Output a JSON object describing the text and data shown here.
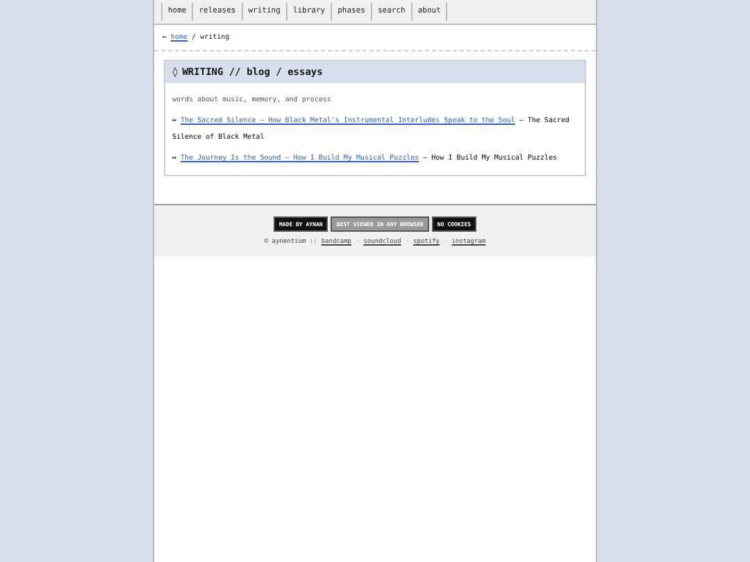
{
  "nav": [
    "home",
    "releases",
    "writing",
    "library",
    "phases",
    "search",
    "about"
  ],
  "breadcrumb": {
    "arrow": "←",
    "link": "home",
    "separator": "/",
    "current": "writing"
  },
  "section": {
    "icon": "◊",
    "title": "WRITING // blog / essays",
    "intro": "words about music, memory, and process",
    "posts": [
      {
        "bullet": "↦",
        "link": "The Sacred Silence – How Black Metal's Instrumental Interludes Speak to the Soul",
        "summary": "– The Sacred Silence of Black Metal"
      },
      {
        "bullet": "↦",
        "link": "The Journey Is the Sound – How I Build My Musical Puzzles",
        "summary": "– How I Build My Musical Puzzles"
      }
    ]
  },
  "footer": {
    "badges": [
      {
        "label": "MADE BY AYNAN",
        "kind": "dark"
      },
      {
        "label": "BEST VIEWED IN ANY BROWSER",
        "kind": "grey"
      },
      {
        "label": "NO COOKIES",
        "kind": "dark"
      }
    ],
    "copyright": "© aynentium ::",
    "links": [
      "bandcamp",
      "soundcloud",
      "spotify",
      "instagram"
    ],
    "separator": "·"
  }
}
